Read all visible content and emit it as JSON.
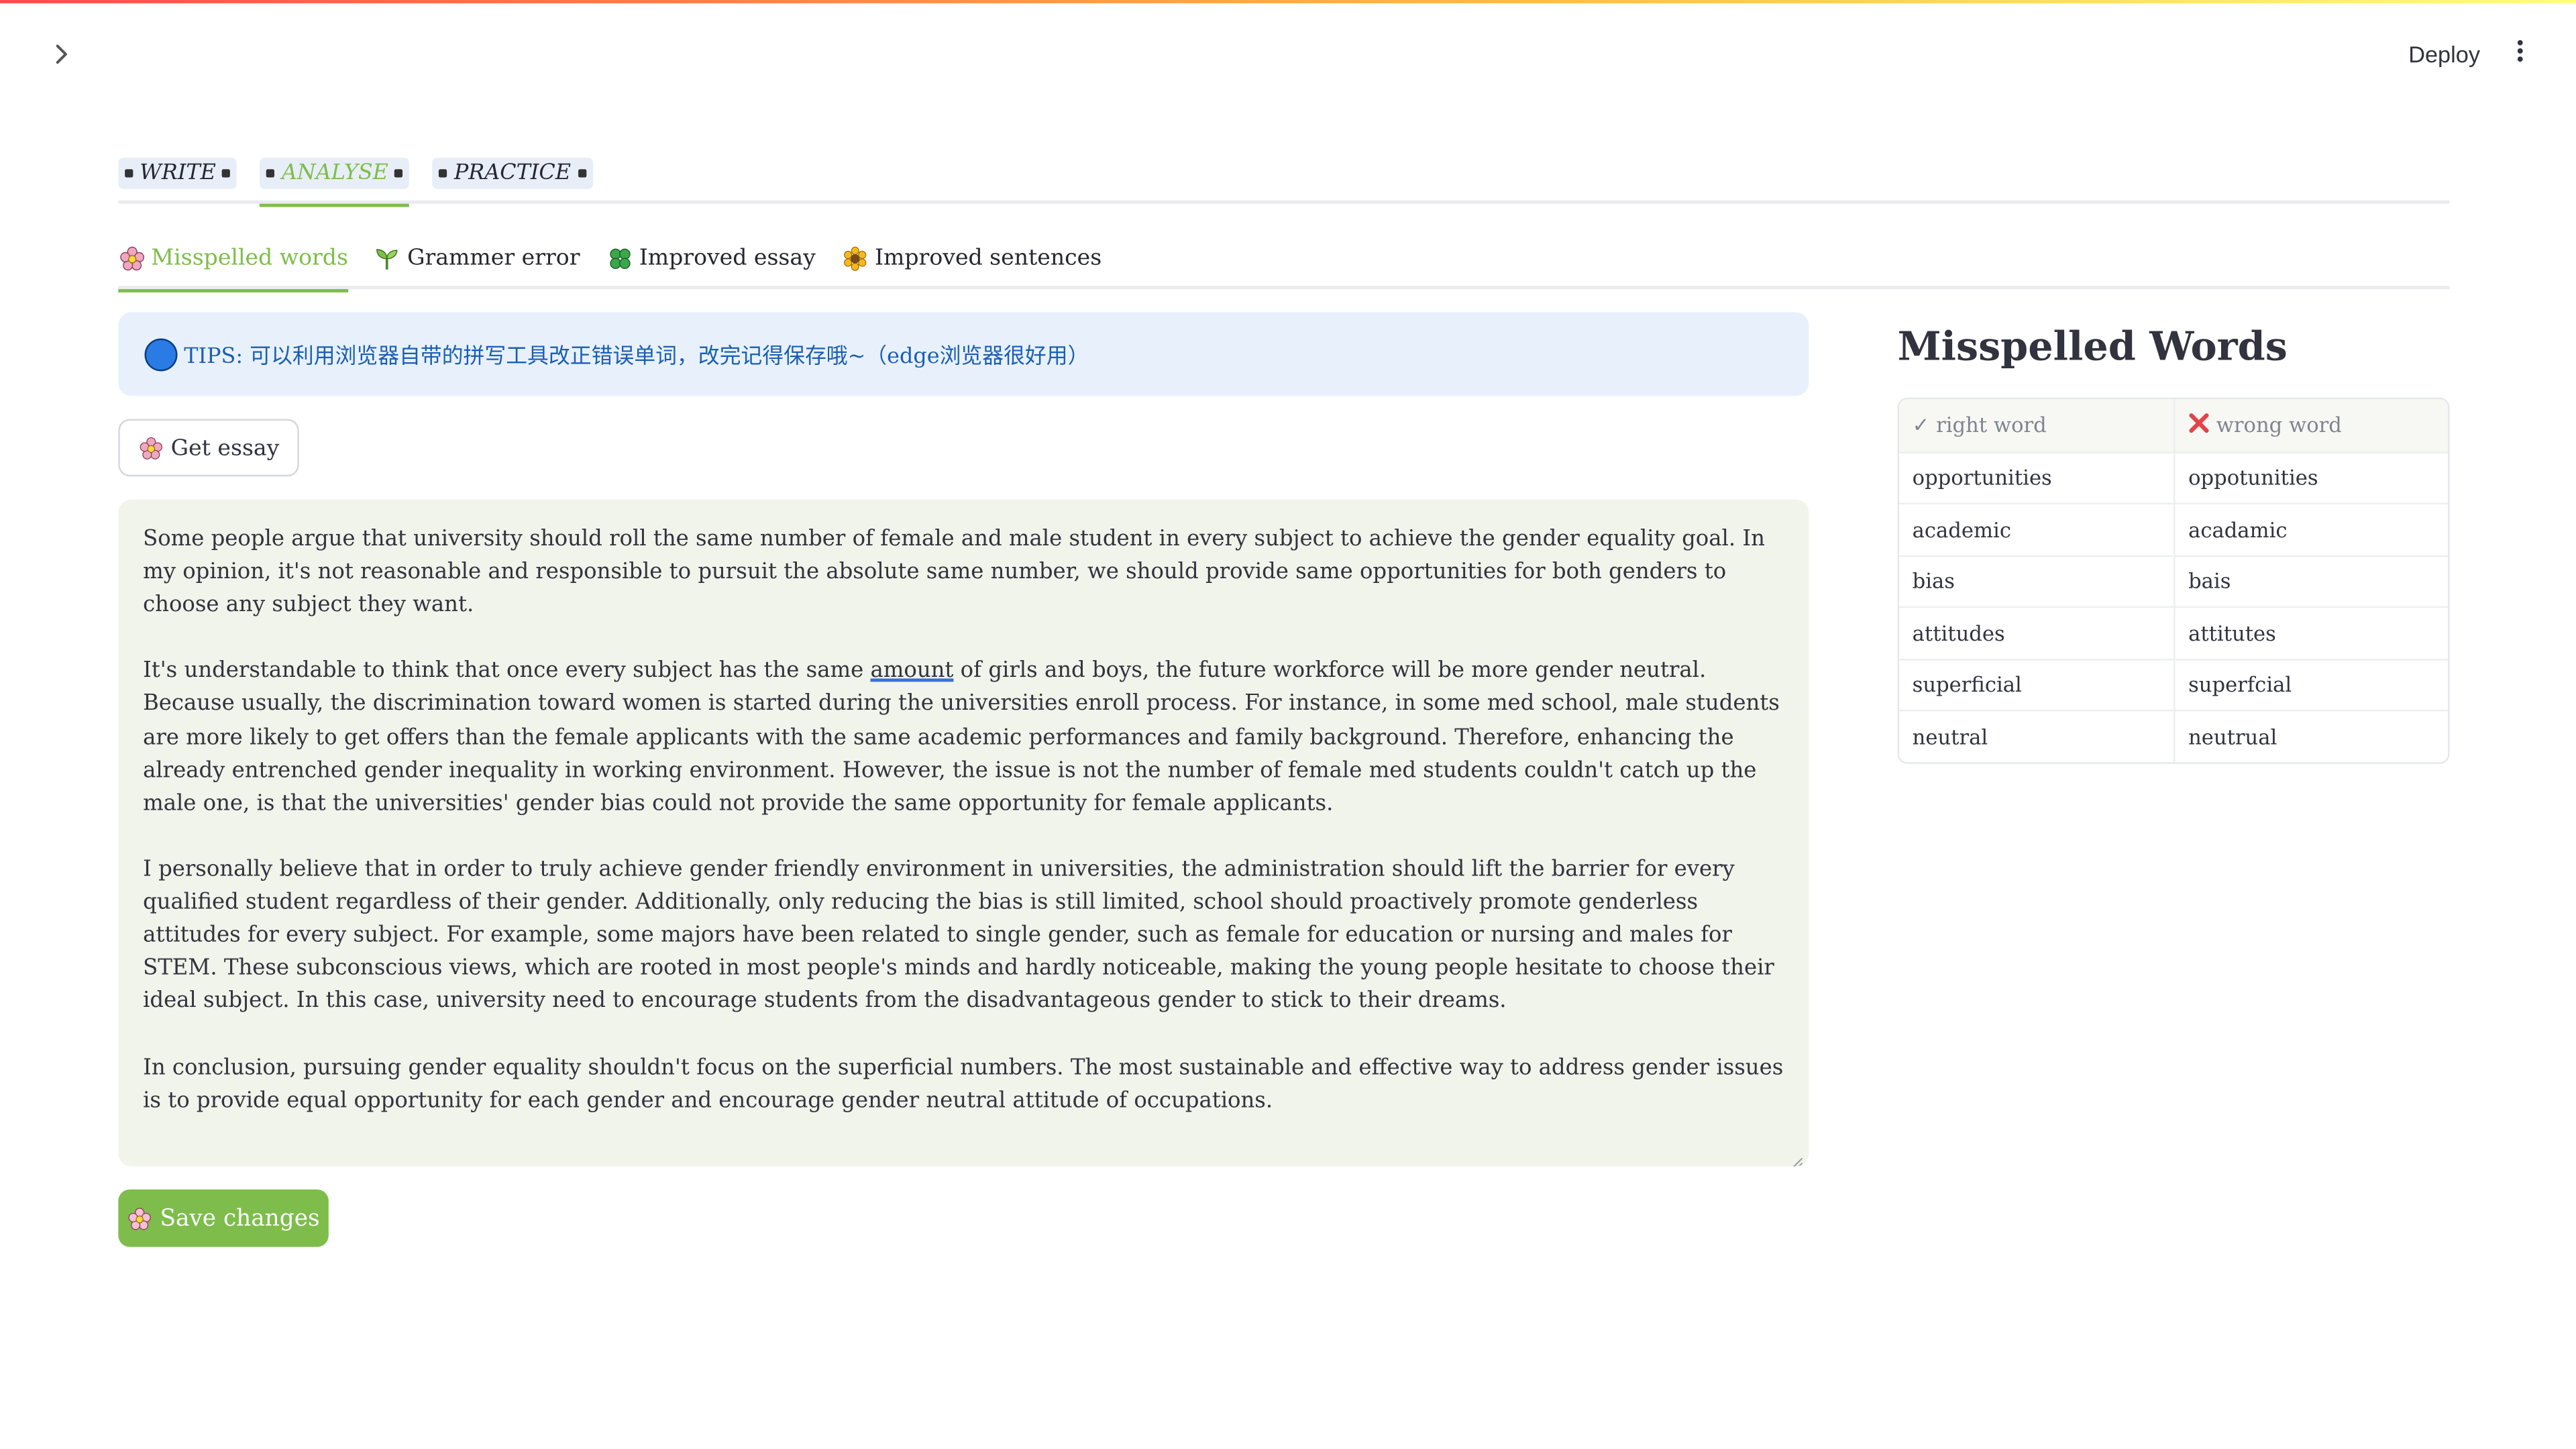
{
  "app": {
    "deploy_label": "Deploy"
  },
  "main_tabs": [
    {
      "label": "WRITE",
      "active": false
    },
    {
      "label": "ANALYSE",
      "active": true
    },
    {
      "label": "PRACTICE",
      "active": false
    }
  ],
  "sub_tabs": [
    {
      "label": "Misspelled words",
      "icon": "flower-icon",
      "active": true
    },
    {
      "label": "Grammer error",
      "icon": "sprout-icon",
      "active": false
    },
    {
      "label": "Improved essay",
      "icon": "clover-icon",
      "active": false
    },
    {
      "label": "Improved sentences",
      "icon": "sunflower-icon",
      "active": false
    }
  ],
  "tips": {
    "text": "TIPS: 可以利用浏览器自带的拼写工具改正错误单词，改完记得保存哦~（edge浏览器很好用）"
  },
  "get_essay_label": "Get essay",
  "essay": {
    "p1": "Some people argue that university should roll the same number of female and male student in every subject to achieve the gender equality goal. In my opinion, it's not reasonable and responsible to pursuit the absolute same number, we should provide same opportunities for both genders to choose any subject they want.",
    "p2_before": "It's understandable to think that once every subject has the same ",
    "p2_underlined": "amount",
    "p2_after": " of girls and boys, the future workforce will be more gender neutral. Because usually, the discrimination toward women is started during the universities enroll process. For instance, in some med school, male students are more likely to get offers than the female applicants with the same academic performances and family background. Therefore, enhancing the already entrenched gender inequality in working environment. However, the issue is not the number of female med students couldn't catch up the male one, is that the universities' gender bias could not provide the same opportunity for female applicants.",
    "p3": "I personally believe that in order to truly achieve gender friendly environment in universities, the administration should lift the barrier for every qualified student regardless of their gender. Additionally, only reducing the bias is still limited, school should proactively promote genderless attitudes for every subject. For example, some majors have been related to single gender, such as female for education or nursing and males for STEM. These subconscious views, which are rooted in most people's minds and hardly noticeable, making the young people hesitate to choose their ideal subject. In this case, university need to encourage students from the disadvantageous gender to stick to their dreams.",
    "p4": "In conclusion, pursuing gender equality shouldn't focus on the superficial numbers. The most sustainable and effective way to address gender issues is to provide equal opportunity for each gender and encourage gender neutral attitude of occupations."
  },
  "save_label": "Save changes",
  "sidebar_panel": {
    "title": "Misspelled Words",
    "col_right": "right word",
    "col_wrong": "wrong word",
    "rows": [
      {
        "right": "opportunities",
        "wrong": "oppotunities"
      },
      {
        "right": "academic",
        "wrong": "acadamic"
      },
      {
        "right": "bias",
        "wrong": "bais"
      },
      {
        "right": "attitudes",
        "wrong": "attitutes"
      },
      {
        "right": "superficial",
        "wrong": "superfcial"
      },
      {
        "right": "neutral",
        "wrong": "neutrual"
      }
    ]
  },
  "colors": {
    "accent": "#7ebd4b",
    "tips_bg": "#e8f1fb",
    "tips_text": "#1a5eb5",
    "essay_bg": "#f1f4ea"
  }
}
